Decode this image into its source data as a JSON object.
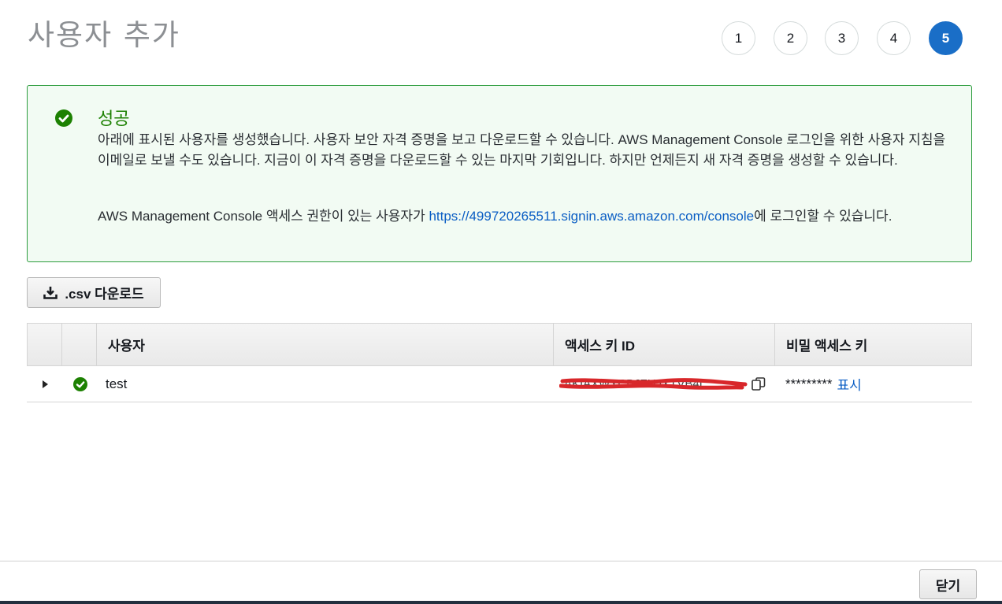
{
  "page": {
    "title": "사용자 추가"
  },
  "steps": [
    "1",
    "2",
    "3",
    "4",
    "5"
  ],
  "active_step": "5",
  "alert": {
    "title": "성공",
    "body": "아래에 표시된 사용자를 생성했습니다. 사용자 보안 자격 증명을 보고 다운로드할 수 있습니다. AWS Management Console 로그인을 위한 사용자 지침을 이메일로 보낼 수도 있습니다. 지금이 이 자격 증명을 다운로드할 수 있는 마지막 기회입니다. 하지만 언제든지 새 자격 증명을 생성할 수 있습니다.",
    "console_prefix": "AWS Management Console 액세스 권한이 있는 사용자가 ",
    "console_link": "https://499720265511.signin.aws.amazon.com/console",
    "console_suffix": "에 로그인할 수 있습니다.",
    "status_color": "#1d8102"
  },
  "toolbar": {
    "download_label": ".csv 다운로드",
    "download_icon": "download-icon"
  },
  "table": {
    "columns": [
      "",
      "",
      "사용자",
      "액세스 키 ID",
      "비밀 액세스 키"
    ],
    "rows": [
      {
        "user": "test",
        "access_key_id": "AKIAXWYCBJZUJXTVB4L",
        "access_key_redacted": true,
        "secret_masked": "*********",
        "secret_show_label": "표시"
      }
    ]
  },
  "footer": {
    "close_label": "닫기"
  }
}
